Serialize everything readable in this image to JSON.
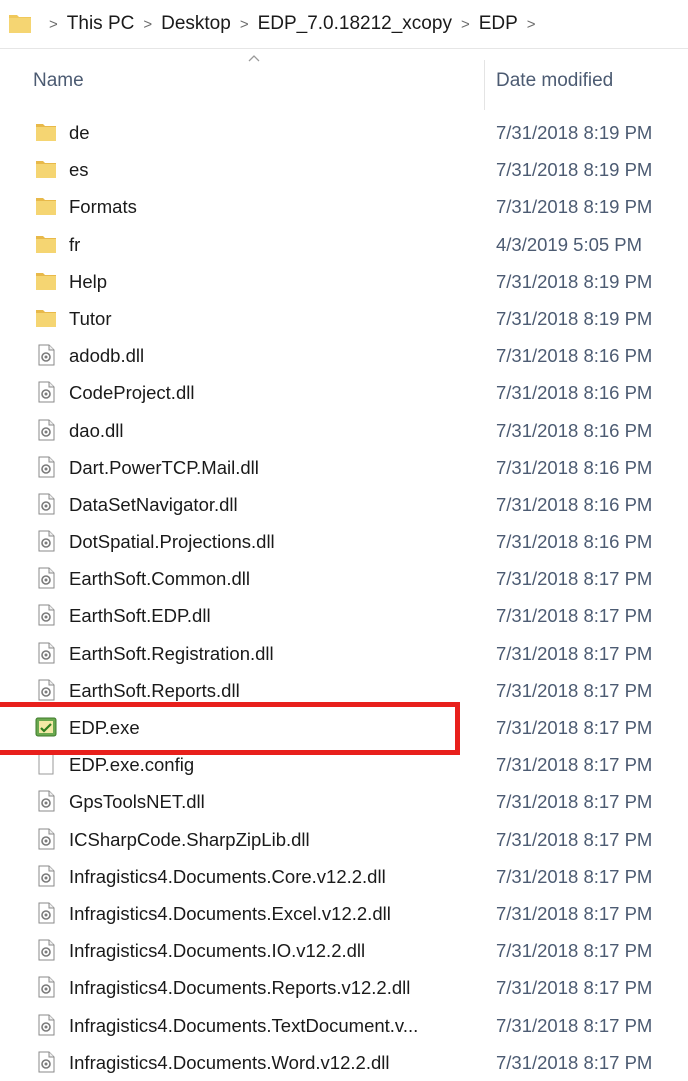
{
  "breadcrumb": {
    "items": [
      "This PC",
      "Desktop",
      "EDP_7.0.18212_xcopy",
      "EDP"
    ],
    "separator": ">"
  },
  "columns": {
    "name": "Name",
    "date": "Date modified"
  },
  "colors": {
    "folder": "#f0c85a",
    "highlight": "#e8201c",
    "date_text": "#4c5b72"
  },
  "files": [
    {
      "name": "de",
      "date": "7/31/2018 8:19 PM",
      "icon": "folder-icon"
    },
    {
      "name": "es",
      "date": "7/31/2018 8:19 PM",
      "icon": "folder-icon"
    },
    {
      "name": "Formats",
      "date": "7/31/2018 8:19 PM",
      "icon": "folder-icon"
    },
    {
      "name": "fr",
      "date": "4/3/2019 5:05 PM",
      "icon": "folder-icon"
    },
    {
      "name": "Help",
      "date": "7/31/2018 8:19 PM",
      "icon": "folder-icon"
    },
    {
      "name": "Tutor",
      "date": "7/31/2018 8:19 PM",
      "icon": "folder-icon"
    },
    {
      "name": "adodb.dll",
      "date": "7/31/2018 8:16 PM",
      "icon": "dll-icon"
    },
    {
      "name": "CodeProject.dll",
      "date": "7/31/2018 8:16 PM",
      "icon": "dll-icon"
    },
    {
      "name": "dao.dll",
      "date": "7/31/2018 8:16 PM",
      "icon": "dll-icon"
    },
    {
      "name": "Dart.PowerTCP.Mail.dll",
      "date": "7/31/2018 8:16 PM",
      "icon": "dll-icon"
    },
    {
      "name": "DataSetNavigator.dll",
      "date": "7/31/2018 8:16 PM",
      "icon": "dll-icon"
    },
    {
      "name": "DotSpatial.Projections.dll",
      "date": "7/31/2018 8:16 PM",
      "icon": "dll-icon"
    },
    {
      "name": "EarthSoft.Common.dll",
      "date": "7/31/2018 8:17 PM",
      "icon": "dll-icon"
    },
    {
      "name": "EarthSoft.EDP.dll",
      "date": "7/31/2018 8:17 PM",
      "icon": "dll-icon"
    },
    {
      "name": "EarthSoft.Registration.dll",
      "date": "7/31/2018 8:17 PM",
      "icon": "dll-icon"
    },
    {
      "name": "EarthSoft.Reports.dll",
      "date": "7/31/2018 8:17 PM",
      "icon": "dll-icon"
    },
    {
      "name": "EDP.exe",
      "date": "7/31/2018 8:17 PM",
      "icon": "exe-icon"
    },
    {
      "name": "EDP.exe.config",
      "date": "7/31/2018 8:17 PM",
      "icon": "config-file-icon"
    },
    {
      "name": "GpsToolsNET.dll",
      "date": "7/31/2018 8:17 PM",
      "icon": "dll-icon"
    },
    {
      "name": "ICSharpCode.SharpZipLib.dll",
      "date": "7/31/2018 8:17 PM",
      "icon": "dll-icon"
    },
    {
      "name": "Infragistics4.Documents.Core.v12.2.dll",
      "date": "7/31/2018 8:17 PM",
      "icon": "dll-icon"
    },
    {
      "name": "Infragistics4.Documents.Excel.v12.2.dll",
      "date": "7/31/2018 8:17 PM",
      "icon": "dll-icon"
    },
    {
      "name": "Infragistics4.Documents.IO.v12.2.dll",
      "date": "7/31/2018 8:17 PM",
      "icon": "dll-icon"
    },
    {
      "name": "Infragistics4.Documents.Reports.v12.2.dll",
      "date": "7/31/2018 8:17 PM",
      "icon": "dll-icon"
    },
    {
      "name": "Infragistics4.Documents.TextDocument.v...",
      "date": "7/31/2018 8:17 PM",
      "icon": "dll-icon"
    },
    {
      "name": "Infragistics4.Documents.Word.v12.2.dll",
      "date": "7/31/2018 8:17 PM",
      "icon": "dll-icon"
    }
  ]
}
